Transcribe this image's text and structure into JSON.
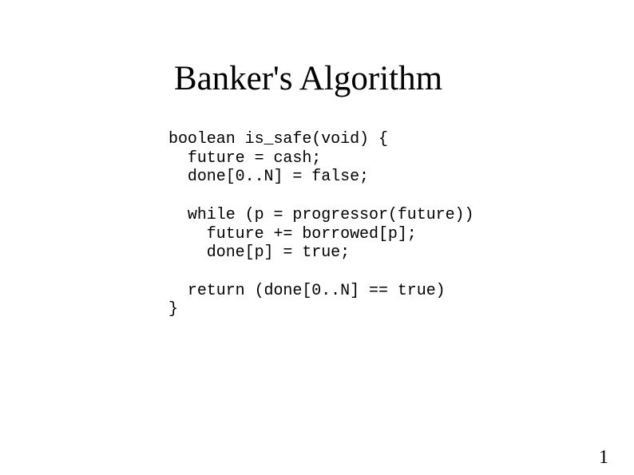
{
  "slide": {
    "title": "Banker's Algorithm",
    "code_lines": [
      "boolean is_safe(void) {",
      "  future = cash;",
      "  done[0..N] = false;",
      "",
      "  while (p = progressor(future))",
      "    future += borrowed[p];",
      "    done[p] = true;",
      "",
      "  return (done[0..N] == true)",
      "}"
    ],
    "page_number": "1"
  }
}
